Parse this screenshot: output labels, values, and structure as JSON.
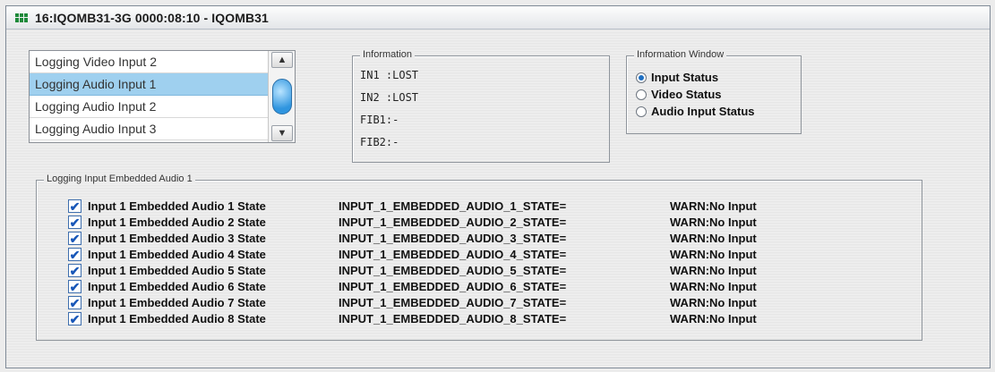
{
  "window": {
    "title": "16:IQOMB31-3G  0000:08:10  - IQOMB31"
  },
  "log_list": {
    "items": [
      "Logging Video Input 2",
      "Logging Audio Input 1",
      "Logging Audio Input 2",
      "Logging Audio Input 3"
    ],
    "selected_index": 1
  },
  "information": {
    "title": "Information",
    "lines": [
      "IN1 :LOST",
      "IN2 :LOST",
      "FIB1:-",
      "FIB2:-"
    ]
  },
  "information_window": {
    "title": "Information Window",
    "options": [
      "Input Status",
      "Video Status",
      "Audio Input Status"
    ],
    "selected_index": 0
  },
  "audio_group": {
    "title": "Logging Input Embedded Audio 1",
    "rows": [
      {
        "label_prefix": "Input 1 Embedded Audio ",
        "label_num": "1",
        "label_suffix": " State",
        "key": "INPUT_1_EMBEDDED_AUDIO_1_STATE=",
        "value": "WARN:No Input",
        "checked": true
      },
      {
        "label_prefix": "Input 1 Embedded Audio ",
        "label_num": "2",
        "label_suffix": " State",
        "key": "INPUT_1_EMBEDDED_AUDIO_2_STATE=",
        "value": "WARN:No Input",
        "checked": true
      },
      {
        "label_prefix": "Input 1 Embedded Audio ",
        "label_num": "3",
        "label_suffix": " State",
        "key": "INPUT_1_EMBEDDED_AUDIO_3_STATE=",
        "value": "WARN:No Input",
        "checked": true
      },
      {
        "label_prefix": "Input 1 Embedded Audio ",
        "label_num": "4",
        "label_suffix": " State",
        "key": "INPUT_1_EMBEDDED_AUDIO_4_STATE=",
        "value": "WARN:No Input",
        "checked": true
      },
      {
        "label_prefix": "Input 1 Embedded Audio ",
        "label_num": "5",
        "label_suffix": " State",
        "key": "INPUT_1_EMBEDDED_AUDIO_5_STATE=",
        "value": "WARN:No Input",
        "checked": true
      },
      {
        "label_prefix": "Input 1 Embedded Audio ",
        "label_num": "6",
        "label_suffix": " State",
        "key": "INPUT_1_EMBEDDED_AUDIO_6_STATE=",
        "value": "WARN:No Input",
        "checked": true
      },
      {
        "label_prefix": "Input 1 Embedded Audio ",
        "label_num": "7",
        "label_suffix": " State",
        "key": "INPUT_1_EMBEDDED_AUDIO_7_STATE=",
        "value": "WARN:No Input",
        "checked": true
      },
      {
        "label_prefix": "Input 1 Embedded Audio ",
        "label_num": "8",
        "label_suffix": " State",
        "key": "INPUT_1_EMBEDDED_AUDIO_8_STATE=",
        "value": "WARN:No Input",
        "checked": true
      }
    ]
  }
}
